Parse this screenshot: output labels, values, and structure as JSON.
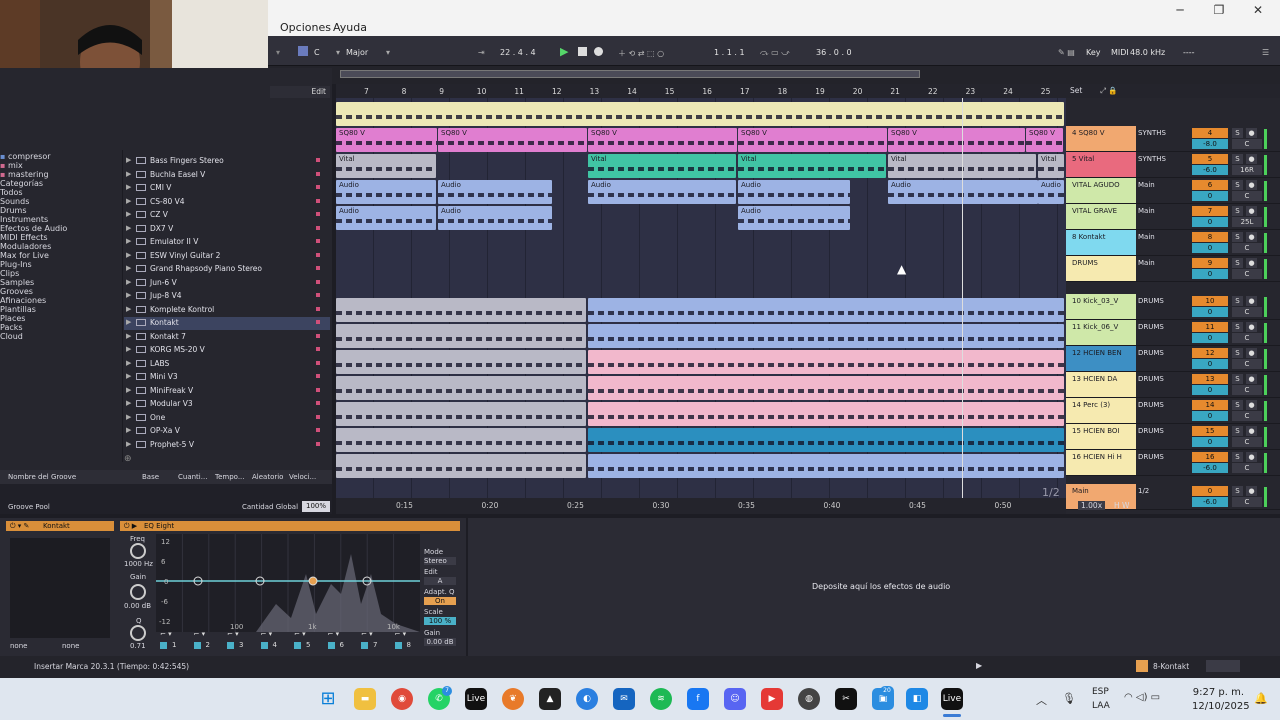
{
  "window": {
    "menus": [
      "Opciones",
      "Ayuda"
    ],
    "minimize": "─",
    "maximize": "❐",
    "close": "✕"
  },
  "control_bar": {
    "key": "C",
    "scale": "Major",
    "position": "22 .  4 .  4",
    "loop_start": "1 .  1 .  1",
    "loop_length": "36 .  0 .  0",
    "key_label": "Key",
    "midi_label": "MIDI",
    "sample_rate": "48.0 kHz",
    "cpu": "----"
  },
  "browser": {
    "edit_label": "Edit",
    "user_items": [
      "compresor",
      "mix",
      "mastering"
    ],
    "categories_title": "Categorías",
    "categories": [
      "Todos",
      "Sounds",
      "Drums",
      "Instruments",
      "Efectos de Audio",
      "MIDI Effects",
      "Moduladores",
      "Max for Live",
      "Plug-Ins",
      "Clips",
      "Samples",
      "Grooves",
      "Afinaciones",
      "Plantillas"
    ],
    "places_title": "Places",
    "places": [
      "Packs",
      "Cloud"
    ],
    "plugins": [
      "Bass Fingers Stereo",
      "Buchla Easel V",
      "CMI V",
      "CS-80 V4",
      "CZ V",
      "DX7 V",
      "Emulator II V",
      "ESW Vinyl Guitar 2",
      "Grand Rhapsody Piano Stereo",
      "Jun-6 V",
      "Jup-8 V4",
      "Komplete Kontrol",
      "Kontakt",
      "Kontakt 7",
      "KORG MS-20 V",
      "LABS",
      "Mini V3",
      "MiniFreak V",
      "Modular V3",
      "One",
      "OP-Xa V",
      "Prophet-5 V"
    ],
    "selected_plugin": "Kontakt"
  },
  "groove_pool": {
    "columns": [
      "Nombre del Groove",
      "Base",
      "Cuanti...",
      "Tempo...",
      "Aleatorio",
      "Veloci..."
    ],
    "title": "Groove Pool",
    "global_label": "Cantidad Global",
    "global_value": "100%"
  },
  "arrangement": {
    "bars": [
      "7",
      "8",
      "9",
      "10",
      "11",
      "12",
      "13",
      "14",
      "15",
      "16",
      "17",
      "18",
      "19",
      "20",
      "21",
      "22",
      "23",
      "24",
      "25"
    ],
    "set_label": "Set",
    "times": [
      "0:15",
      "0:20",
      "0:25",
      "0:30",
      "0:35",
      "0:40",
      "0:45",
      "0:50"
    ],
    "page": "1/2",
    "clip_labels": {
      "sq80": "SQ80 V",
      "vital": "Vital",
      "audio": "Audio"
    }
  },
  "tracks": [
    {
      "name": "4 SQ80 V",
      "route": "SYNTHS",
      "num": "4",
      "vol": "-8.0",
      "pan": "C",
      "color": "#f1a870"
    },
    {
      "name": "5 Vital",
      "route": "SYNTHS",
      "num": "5",
      "vol": "-6.0",
      "pan": "16R",
      "color": "#e96a7e"
    },
    {
      "name": "VITAL AGUDO",
      "route": "Main",
      "num": "6",
      "vol": "0",
      "pan": "C",
      "color": "#cfe8a9"
    },
    {
      "name": "VITAL GRAVE",
      "route": "Main",
      "num": "7",
      "vol": "0",
      "pan": "25L",
      "color": "#cfe8a9"
    },
    {
      "name": "8 Kontakt",
      "route": "Main",
      "num": "8",
      "vol": "0",
      "pan": "C",
      "color": "#7fd9ef"
    },
    {
      "name": "DRUMS",
      "route": "Main",
      "num": "9",
      "vol": "0",
      "pan": "C",
      "color": "#f6eab0"
    },
    {
      "name": "10 Kick_03_V",
      "route": "DRUMS",
      "num": "10",
      "vol": "0",
      "pan": "C",
      "color": "#cfe8a9"
    },
    {
      "name": "11 Kick_06_V",
      "route": "DRUMS",
      "num": "11",
      "vol": "0",
      "pan": "C",
      "color": "#cfe8a9"
    },
    {
      "name": "12 HCIEN BEN",
      "route": "DRUMS",
      "num": "12",
      "vol": "0",
      "pan": "C",
      "color": "#3d8fc4"
    },
    {
      "name": "13 HCIEN DA",
      "route": "DRUMS",
      "num": "13",
      "vol": "0",
      "pan": "C",
      "color": "#f6eab0"
    },
    {
      "name": "14 Perc (3)",
      "route": "DRUMS",
      "num": "14",
      "vol": "0",
      "pan": "C",
      "color": "#f6eab0"
    },
    {
      "name": "15 HCIEN BOI",
      "route": "DRUMS",
      "num": "15",
      "vol": "0",
      "pan": "C",
      "color": "#f6eab0"
    },
    {
      "name": "16 HCIEN Hi H",
      "route": "DRUMS",
      "num": "16",
      "vol": "-6.0",
      "pan": "C",
      "color": "#f6eab0"
    },
    {
      "name": "Main",
      "route": "1/2",
      "num": "0",
      "vol": "-6.0",
      "pan": "C",
      "color": "#f1a870"
    }
  ],
  "zoom": "1.00x",
  "device": {
    "kontakt_title": "Kontakt",
    "none1": "none",
    "none2": "none",
    "eq_title": "EQ Eight",
    "freq_label": "Freq",
    "freq_value": "1000 Hz",
    "gain_label": "Gain",
    "gain_value": "0.00 dB",
    "q_label": "Q",
    "q_value": "0.71",
    "db_scale": [
      "12",
      "6",
      "0",
      "-6",
      "-12"
    ],
    "freq_scale": [
      "100",
      "1k",
      "10k"
    ],
    "mode_label": "Mode",
    "mode_value": "Stereo",
    "edit_label": "Edit",
    "edit_value": "A",
    "adapt_label": "Adapt. Q",
    "adapt_value": "On",
    "scale_label": "Scale",
    "scale_value": "100 %",
    "outgain_label": "Gain",
    "outgain_value": "0.00 dB",
    "band_numbers": [
      "1",
      "2",
      "3",
      "4",
      "5",
      "6",
      "7",
      "8"
    ]
  },
  "dropzone_text": "Deposite aquí los efectos de audio",
  "status": {
    "message": "Insertar Marca 20.3.1 (Tiempo: 0:42:545)",
    "track": "8-Kontakt"
  },
  "taskbar": {
    "lang1": "ESP",
    "lang2": "LAA",
    "time": "9:27 p. m.",
    "date": "12/10/2025",
    "live_label": "Live",
    "badge1": "7",
    "badge2": "20"
  }
}
